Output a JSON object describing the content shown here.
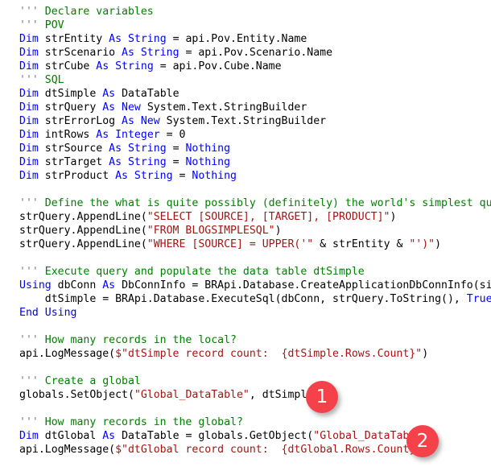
{
  "editor": {
    "language": "VB.NET",
    "colors": {
      "background": "#ffffff",
      "keyword": "#0000ff",
      "comment": "#008000",
      "comment_marker": "#808080",
      "string": "#a31515",
      "identifier": "#000000",
      "badge": "#f5414a",
      "badge_text": "#ffffff"
    },
    "lines": [
      {
        "id": "l1",
        "indent": 0,
        "tokens": [
          {
            "t": "cmq",
            "s": "''' "
          },
          {
            "t": "cm",
            "s": "Declare variables"
          }
        ]
      },
      {
        "id": "l2",
        "indent": 0,
        "tokens": [
          {
            "t": "cmq",
            "s": "''' "
          },
          {
            "t": "cm",
            "s": "POV"
          }
        ]
      },
      {
        "id": "l3",
        "indent": 0,
        "tokens": [
          {
            "t": "kw",
            "s": "Dim"
          },
          {
            "t": "id",
            "s": " strEntity "
          },
          {
            "t": "kw",
            "s": "As String"
          },
          {
            "t": "id",
            "s": " = api.Pov.Entity.Name"
          }
        ]
      },
      {
        "id": "l4",
        "indent": 0,
        "tokens": [
          {
            "t": "kw",
            "s": "Dim"
          },
          {
            "t": "id",
            "s": " strScenario "
          },
          {
            "t": "kw",
            "s": "As String"
          },
          {
            "t": "id",
            "s": " = api.Pov.Scenario.Name"
          }
        ]
      },
      {
        "id": "l5",
        "indent": 0,
        "tokens": [
          {
            "t": "kw",
            "s": "Dim"
          },
          {
            "t": "id",
            "s": " strCube "
          },
          {
            "t": "kw",
            "s": "As String"
          },
          {
            "t": "id",
            "s": " = api.Pov.Cube.Name"
          }
        ]
      },
      {
        "id": "l6",
        "indent": 0,
        "tokens": [
          {
            "t": "cmq",
            "s": "''' "
          },
          {
            "t": "cm",
            "s": "SQL"
          }
        ]
      },
      {
        "id": "l7",
        "indent": 0,
        "tokens": [
          {
            "t": "kw",
            "s": "Dim"
          },
          {
            "t": "id",
            "s": " dtSimple "
          },
          {
            "t": "kw",
            "s": "As"
          },
          {
            "t": "id",
            "s": " DataTable"
          }
        ]
      },
      {
        "id": "l8",
        "indent": 0,
        "tokens": [
          {
            "t": "kw",
            "s": "Dim"
          },
          {
            "t": "id",
            "s": " strQuery "
          },
          {
            "t": "kw",
            "s": "As New"
          },
          {
            "t": "id",
            "s": " System.Text.StringBuilder"
          }
        ]
      },
      {
        "id": "l9",
        "indent": 0,
        "tokens": [
          {
            "t": "kw",
            "s": "Dim"
          },
          {
            "t": "id",
            "s": " strErrorLog "
          },
          {
            "t": "kw",
            "s": "As New"
          },
          {
            "t": "id",
            "s": " System.Text.StringBuilder"
          }
        ]
      },
      {
        "id": "l10",
        "indent": 0,
        "tokens": [
          {
            "t": "kw",
            "s": "Dim"
          },
          {
            "t": "id",
            "s": " intRows "
          },
          {
            "t": "kw",
            "s": "As Integer"
          },
          {
            "t": "id",
            "s": " = 0"
          }
        ]
      },
      {
        "id": "l11",
        "indent": 0,
        "tokens": [
          {
            "t": "kw",
            "s": "Dim"
          },
          {
            "t": "id",
            "s": " strSource "
          },
          {
            "t": "kw",
            "s": "As String"
          },
          {
            "t": "id",
            "s": " = "
          },
          {
            "t": "kw",
            "s": "Nothing"
          }
        ]
      },
      {
        "id": "l12",
        "indent": 0,
        "tokens": [
          {
            "t": "kw",
            "s": "Dim"
          },
          {
            "t": "id",
            "s": " strTarget "
          },
          {
            "t": "kw",
            "s": "As String"
          },
          {
            "t": "id",
            "s": " = "
          },
          {
            "t": "kw",
            "s": "Nothing"
          }
        ]
      },
      {
        "id": "l13",
        "indent": 0,
        "tokens": [
          {
            "t": "kw",
            "s": "Dim"
          },
          {
            "t": "id",
            "s": " strProduct "
          },
          {
            "t": "kw",
            "s": "As String"
          },
          {
            "t": "id",
            "s": " = "
          },
          {
            "t": "kw",
            "s": "Nothing"
          }
        ]
      },
      {
        "id": "l14",
        "indent": 0,
        "tokens": []
      },
      {
        "id": "l15",
        "indent": 0,
        "tokens": [
          {
            "t": "cmq",
            "s": "''' "
          },
          {
            "t": "cm",
            "s": "Define the what is quite possibly (definitely) the world's simplest query"
          }
        ]
      },
      {
        "id": "l16",
        "indent": 0,
        "tokens": [
          {
            "t": "id",
            "s": "strQuery.AppendLine("
          },
          {
            "t": "str",
            "s": "\"SELECT [SOURCE], [TARGET], [PRODUCT]\""
          },
          {
            "t": "id",
            "s": ")"
          }
        ]
      },
      {
        "id": "l17",
        "indent": 0,
        "tokens": [
          {
            "t": "id",
            "s": "strQuery.AppendLine("
          },
          {
            "t": "str",
            "s": "\"FROM BLOGSIMPLESQL\""
          },
          {
            "t": "id",
            "s": ")"
          }
        ]
      },
      {
        "id": "l18",
        "indent": 0,
        "tokens": [
          {
            "t": "id",
            "s": "strQuery.AppendLine("
          },
          {
            "t": "str",
            "s": "\"WHERE [SOURCE] = UPPER('\""
          },
          {
            "t": "id",
            "s": " & strEntity & "
          },
          {
            "t": "str",
            "s": "\"')\""
          },
          {
            "t": "id",
            "s": ")"
          }
        ]
      },
      {
        "id": "l19",
        "indent": 0,
        "tokens": []
      },
      {
        "id": "l20",
        "indent": 0,
        "tokens": [
          {
            "t": "cmq",
            "s": "''' "
          },
          {
            "t": "cm",
            "s": "Execute query and populate the data table dtSimple"
          }
        ]
      },
      {
        "id": "l21",
        "indent": 0,
        "tokens": [
          {
            "t": "kw",
            "s": "Using"
          },
          {
            "t": "id",
            "s": " dbConn "
          },
          {
            "t": "kw",
            "s": "As"
          },
          {
            "t": "id",
            "s": " DbConnInfo = BRApi.Database.CreateApplicationDbConnInfo(si)"
          }
        ]
      },
      {
        "id": "l22",
        "indent": 1,
        "tokens": [
          {
            "t": "id",
            "s": "dtSimple = BRApi.Database.ExecuteSql(dbConn, strQuery.ToString(), "
          },
          {
            "t": "kw",
            "s": "True"
          },
          {
            "t": "id",
            "s": ")"
          }
        ]
      },
      {
        "id": "l23",
        "indent": 0,
        "tokens": [
          {
            "t": "kw",
            "s": "End Using"
          }
        ]
      },
      {
        "id": "l24",
        "indent": 0,
        "tokens": []
      },
      {
        "id": "l25",
        "indent": 0,
        "tokens": [
          {
            "t": "cmq",
            "s": "''' "
          },
          {
            "t": "cm",
            "s": "How many records in the local?"
          }
        ]
      },
      {
        "id": "l26",
        "indent": 0,
        "tokens": [
          {
            "t": "id",
            "s": "api.LogMessage("
          },
          {
            "t": "str",
            "s": "$\"dtSimple record count:  {dtSimple.Rows.Count}\""
          },
          {
            "t": "id",
            "s": ")"
          }
        ]
      },
      {
        "id": "l27",
        "indent": 0,
        "tokens": []
      },
      {
        "id": "l28",
        "indent": 0,
        "tokens": [
          {
            "t": "cmq",
            "s": "''' "
          },
          {
            "t": "cm",
            "s": "Create a global"
          }
        ]
      },
      {
        "id": "l29",
        "indent": 0,
        "tokens": [
          {
            "t": "id",
            "s": "globals.SetObject("
          },
          {
            "t": "str",
            "s": "\"Global_DataTable\""
          },
          {
            "t": "id",
            "s": ", dtSimple)"
          }
        ]
      },
      {
        "id": "l30",
        "indent": 0,
        "tokens": []
      },
      {
        "id": "l31",
        "indent": 0,
        "tokens": [
          {
            "t": "cmq",
            "s": "''' "
          },
          {
            "t": "cm",
            "s": "How many records in the global?"
          }
        ]
      },
      {
        "id": "l32",
        "indent": 0,
        "tokens": [
          {
            "t": "kw",
            "s": "Dim"
          },
          {
            "t": "id",
            "s": " dtGlobal "
          },
          {
            "t": "kw",
            "s": "As"
          },
          {
            "t": "id",
            "s": " DataTable = globals.GetObject("
          },
          {
            "t": "str",
            "s": "\"Global_DataTable\""
          },
          {
            "t": "id",
            "s": ")"
          }
        ]
      },
      {
        "id": "l33",
        "indent": 0,
        "tokens": [
          {
            "t": "id",
            "s": "api.LogMessage("
          },
          {
            "t": "str",
            "s": "$\"dtGlobal record count:  {dtGlobal.Rows.Count}\""
          },
          {
            "t": "id",
            "s": ")"
          }
        ]
      }
    ]
  },
  "annotations": [
    {
      "id": "badge-1",
      "label": "1"
    },
    {
      "id": "badge-2",
      "label": "2"
    }
  ]
}
